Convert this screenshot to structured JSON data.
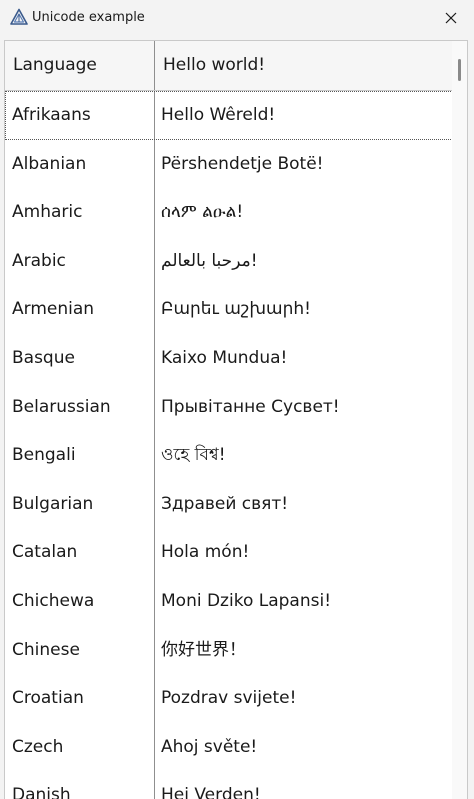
{
  "window": {
    "title": "Unicode example",
    "icon": "app-triangle-icon",
    "close_icon": "close-icon"
  },
  "table": {
    "columns": [
      "Language",
      "Hello world!"
    ],
    "selected_row": 0,
    "rows": [
      {
        "language": "Afrikaans",
        "hello": "Hello Wêreld!"
      },
      {
        "language": "Albanian",
        "hello": "Përshendetje Botë!"
      },
      {
        "language": "Amharic",
        "hello": "ሰላም ልዑል!"
      },
      {
        "language": "Arabic",
        "hello": "مرحبا بالعالم!"
      },
      {
        "language": "Armenian",
        "hello": "Բարեւ աշխարհ!"
      },
      {
        "language": "Basque",
        "hello": "Kaixo Mundua!"
      },
      {
        "language": "Belarussian",
        "hello": "Прывітанне Сусвет!"
      },
      {
        "language": "Bengali",
        "hello": "ওহে বিশ্ব!"
      },
      {
        "language": "Bulgarian",
        "hello": "Здравей свят!"
      },
      {
        "language": "Catalan",
        "hello": "Hola món!"
      },
      {
        "language": "Chichewa",
        "hello": "Moni Dziko Lapansi!"
      },
      {
        "language": "Chinese",
        "hello": "你好世界！"
      },
      {
        "language": "Croatian",
        "hello": "Pozdrav svijete!"
      },
      {
        "language": "Czech",
        "hello": "Ahoj světe!"
      },
      {
        "language": "Danish",
        "hello": "Hej Verden!"
      }
    ]
  }
}
